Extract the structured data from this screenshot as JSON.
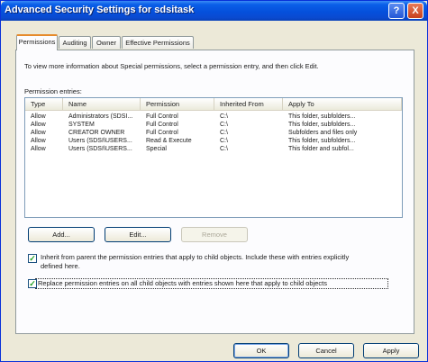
{
  "window": {
    "title": "Advanced Security Settings for sdsitask",
    "help_glyph": "?",
    "close_glyph": "X"
  },
  "tabs": [
    {
      "label": "Permissions",
      "active": true
    },
    {
      "label": "Auditing",
      "active": false
    },
    {
      "label": "Owner",
      "active": false
    },
    {
      "label": "Effective Permissions",
      "active": false
    }
  ],
  "intro_text": "To view more information about Special permissions, select a permission entry, and then click Edit.",
  "entries_label": "Permission entries:",
  "table": {
    "columns": [
      "Type",
      "Name",
      "Permission",
      "Inherited From",
      "Apply To"
    ],
    "rows": [
      [
        "Allow",
        "Administrators (SDSI...",
        "Full Control",
        "C:\\",
        "This folder, subfolders..."
      ],
      [
        "Allow",
        "SYSTEM",
        "Full Control",
        "C:\\",
        "This folder, subfolders..."
      ],
      [
        "Allow",
        "CREATOR OWNER",
        "Full Control",
        "C:\\",
        "Subfolders and files only"
      ],
      [
        "Allow",
        "Users (SDSI\\USERS...",
        "Read & Execute",
        "C:\\",
        "This folder, subfolders..."
      ],
      [
        "Allow",
        "Users (SDSI\\USERS...",
        "Special",
        "C:\\",
        "This folder and subfol..."
      ]
    ]
  },
  "buttons": {
    "add": "Add...",
    "edit": "Edit...",
    "remove": "Remove",
    "ok": "OK",
    "cancel": "Cancel",
    "apply": "Apply"
  },
  "options": {
    "inherit_line1": "Inherit from parent the permission entries that apply to child objects. Include these with entries explicitly",
    "inherit_line2": "defined here.",
    "inherit_checked": true,
    "replace_label": "Replace permission entries on all child objects with entries shown here that apply to child objects",
    "replace_checked": true
  },
  "colors": {
    "titlebar": "#0550dc",
    "dialog_bg": "#ece9d8",
    "check_mark": "#21a121",
    "active_tab_accent": "#e68b2c"
  }
}
